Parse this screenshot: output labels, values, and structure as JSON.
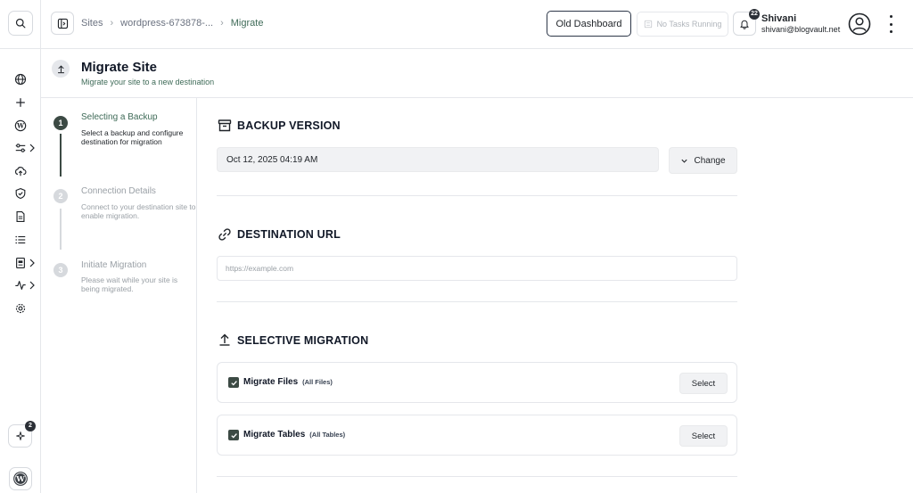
{
  "breadcrumb": {
    "items": [
      "Sites",
      "wordpress-673878-...",
      "Migrate"
    ]
  },
  "header": {
    "old_dashboard_label": "Old Dashboard",
    "tasks_label": "No Tasks Running",
    "notifications_count": "22",
    "user_name": "Shivani",
    "user_email": "shivani@blogvault.net"
  },
  "rail": {
    "items": [
      "globe-icon",
      "plus-icon",
      "wordpress-icon",
      "settings-sliders-icon",
      "cloud-upload-icon",
      "shield-check-icon",
      "document-icon",
      "list-icon",
      "report-icon",
      "activity-icon",
      "gear-icon"
    ],
    "ai_badge_count": "2"
  },
  "page": {
    "title": "Migrate Site",
    "subtitle": "Migrate your site to a new destination"
  },
  "steps": [
    {
      "num": "1",
      "title": "Selecting a Backup",
      "desc": "Select a backup and configure destination for migration",
      "active": true
    },
    {
      "num": "2",
      "title": "Connection Details",
      "desc": "Connect to your destination site to enable migration.",
      "active": false
    },
    {
      "num": "3",
      "title": "Initiate Migration",
      "desc": "Please wait while your site is being migrated.",
      "active": false
    }
  ],
  "backup": {
    "title": "BACKUP VERSION",
    "value": "Oct 12, 2025 04:19 AM",
    "change_label": "Change"
  },
  "destination": {
    "title": "DESTINATION URL",
    "placeholder": "https://example.com",
    "value": ""
  },
  "selective": {
    "title": "SELECTIVE MIGRATION",
    "files": {
      "label": "Migrate Files",
      "sub": "(All Files)",
      "button": "Select",
      "checked": true
    },
    "tables": {
      "label": "Migrate Tables",
      "sub": "(All Tables)",
      "button": "Select",
      "checked": true
    }
  },
  "colors": {
    "accent_green": "#3f6b58",
    "step_active": "#3c4a44",
    "border": "#e5e7eb"
  }
}
